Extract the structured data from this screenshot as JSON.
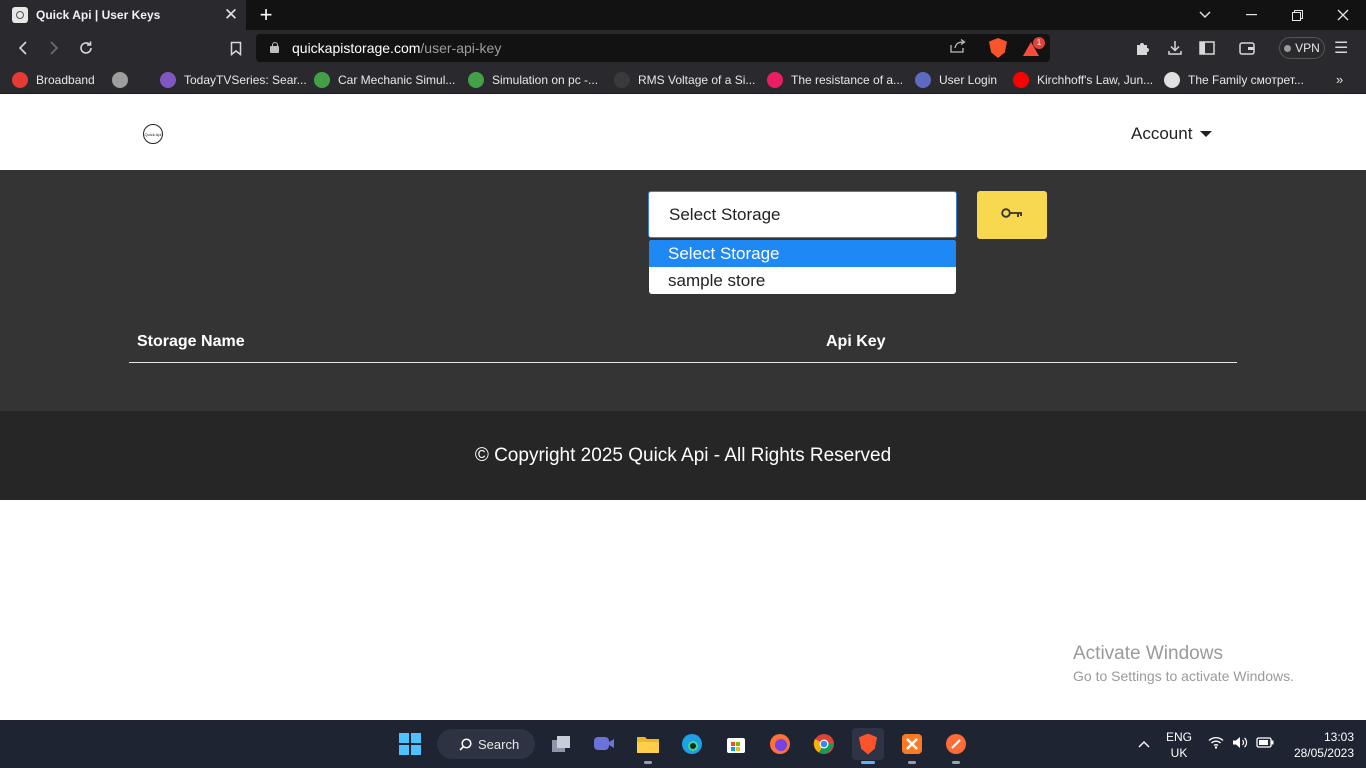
{
  "browser": {
    "tab_title": "Quick Api | User Keys",
    "url_host": "quickapistorage.com",
    "url_path": "/user-api-key",
    "vpn_label": "VPN",
    "rewards_badge": "1",
    "bookmarks": [
      {
        "label": "Broadband",
        "icon": "broadband-icon",
        "color": "#e53935"
      },
      {
        "label": "",
        "icon": "globe-icon",
        "color": "#9e9e9e"
      },
      {
        "label": "TodayTVSeries: Sear...",
        "icon": "tv-icon",
        "color": "#7e57c2"
      },
      {
        "label": "Car Mechanic Simul...",
        "icon": "shield-green-icon",
        "color": "#43a047"
      },
      {
        "label": "Simulation on pc -...",
        "icon": "shield-green-icon",
        "color": "#43a047"
      },
      {
        "label": "RMS Voltage of a Si...",
        "icon": "dark-circle-icon",
        "color": "#3a3a3a"
      },
      {
        "label": "The resistance of a...",
        "icon": "s-icon",
        "color": "#e91e63"
      },
      {
        "label": "User Login",
        "icon": "user-login-icon",
        "color": "#5c6bc0"
      },
      {
        "label": "Kirchhoff's Law, Jun...",
        "icon": "youtube-icon",
        "color": "#ff0000"
      },
      {
        "label": "The Family смотрет...",
        "icon": "film-icon",
        "color": "#e0e0e0"
      }
    ]
  },
  "header": {
    "logo_text": "Quick Api",
    "account_label": "Account"
  },
  "storage_select": {
    "value": "Select Storage",
    "options": [
      "Select Storage",
      "sample store"
    ],
    "selected_index": 0
  },
  "table": {
    "columns": [
      "Storage Name",
      "Api Key"
    ]
  },
  "footer": {
    "copyright": "© Copyright 2025 Quick Api - All Rights Reserved"
  },
  "watermark": {
    "line1": "Activate Windows",
    "line2": "Go to Settings to activate Windows."
  },
  "taskbar": {
    "search_label": "Search",
    "language": "ENG",
    "region": "UK",
    "time": "13:03",
    "date": "28/05/2023"
  },
  "colors": {
    "accent_button": "#f8d84e",
    "dropdown_highlight": "#1e88f5",
    "main_bg": "#343434",
    "footer_bg": "#262626"
  }
}
